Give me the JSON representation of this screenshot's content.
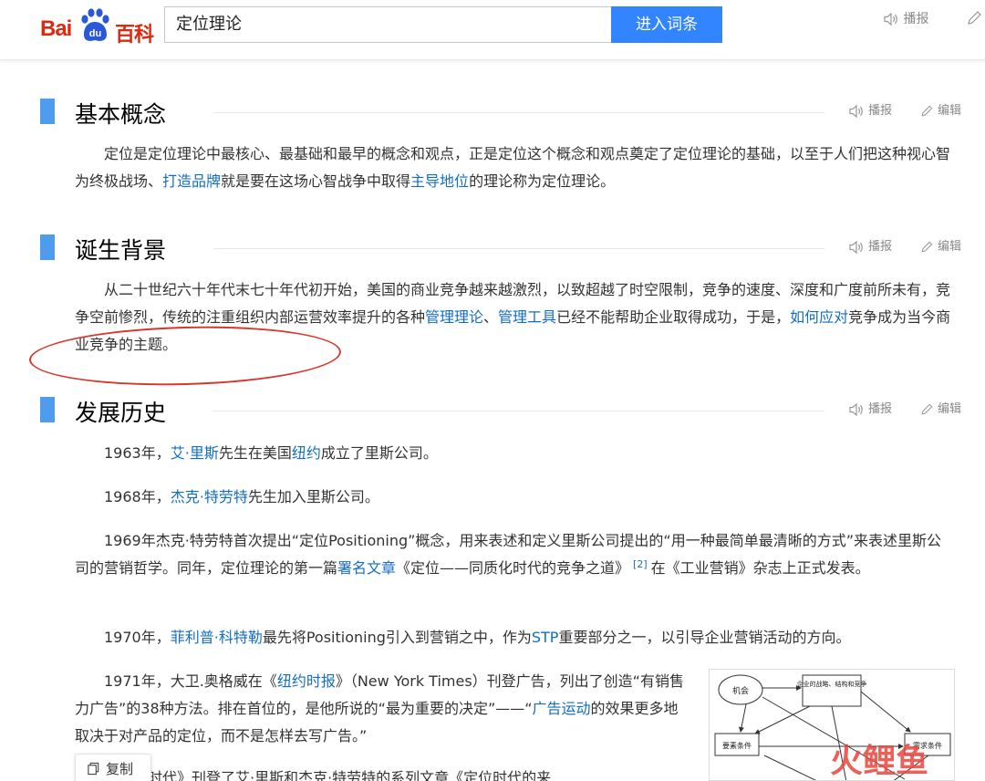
{
  "header": {
    "logo_left": "Bai",
    "logo_paw": "du",
    "logo_right": "百科",
    "search_value": "定位理论",
    "search_button": "进入词条",
    "listen_label": "播报"
  },
  "sections": [
    {
      "title": "基本概念",
      "listen": "播报",
      "edit": "编辑"
    },
    {
      "title": "诞生背景",
      "listen": "播报",
      "edit": "编辑"
    },
    {
      "title": "发展历史",
      "listen": "播报",
      "edit": "编辑"
    }
  ],
  "concept": {
    "t1": "定位是定位理论中最核心、最基础和最早的概念和观点，正是定位这个概念和观点奠定了定位理论的基础，以至于人们把这种视心智为终极战场、",
    "link1": "打造品牌",
    "t2": "就是要在这场心智战争中取得",
    "link2": "主导地位",
    "t3": "的理论称为定位理论。"
  },
  "background": {
    "t1": "从二十世纪六十年代末七十年代初开始，美国的商业竞争越来越激烈，以致超越了时空限制，竞争的速度、深度和广度前所未有，竞争空前惨烈，传统的注重组织内部运营效率提升的各种",
    "link1": "管理理论",
    "t2": "、",
    "link2": "管理工具",
    "t3": "已经不能帮助企业取得成功，于是，",
    "link3": "如何应对",
    "t4": "竞争成为当今商业竞争的主题。"
  },
  "history": {
    "p1": {
      "t1": "1963年，",
      "link1": "艾·里斯",
      "t2": "先生在美国",
      "link2": "纽约",
      "t3": "成立了里斯公司。"
    },
    "p2": {
      "t1": "1968年，",
      "link1": "杰克·特劳特",
      "t2": "先生加入里斯公司。"
    },
    "p3": {
      "t1": "1969年杰克·特劳特首次提出“定位Positioning”概念，用来表述和定义里斯公司提出的“用一种最简单最清晰的方式”来表述里斯公司的营销哲学。同年，定位理论的第一篇",
      "link1": "署名文章",
      "t2": "《定位——同质化时代的竞争之道》",
      "sup": "[2]",
      "t3": "在《工业营销》杂志上正式发表。"
    },
    "p4": {
      "t1": "1970年，",
      "link1": "菲利普·科特勒",
      "t2": "最先将Positioning引入到营销之中，作为",
      "link2": "STP",
      "t3": "重要部分之一，以引导企业营销活动的方向。"
    },
    "p5": {
      "t1": "1971年，大卫.奥格威在《",
      "link1": "纽约时报",
      "t2": "》（New York Times）刊登广告，列出了创造“有销售力广告”的38种方法。排在首位的，是他所说的“最为重要的决定”——“",
      "link2": "广告运动",
      "t3": "的效果更多地取决于对产品的定位，而不是怎样去写广告。”"
    },
    "p6": {
      "t1": "《广告时代》刊登了艾·里斯和杰克·特劳特的系列文章《定位时代的来"
    }
  },
  "diagram": {
    "node1": "机会",
    "node2": "企业的战略、结构和竞争",
    "node3": "要素条件",
    "node4": "需求条件"
  },
  "copy_button": "复制",
  "watermark": "火鲤鱼",
  "colors": {
    "brand_red": "#de2910",
    "search_blue": "#3385ff",
    "link_blue": "#136ec2",
    "section_bar": "#4f9cee",
    "annotation_red": "#d6372d"
  }
}
